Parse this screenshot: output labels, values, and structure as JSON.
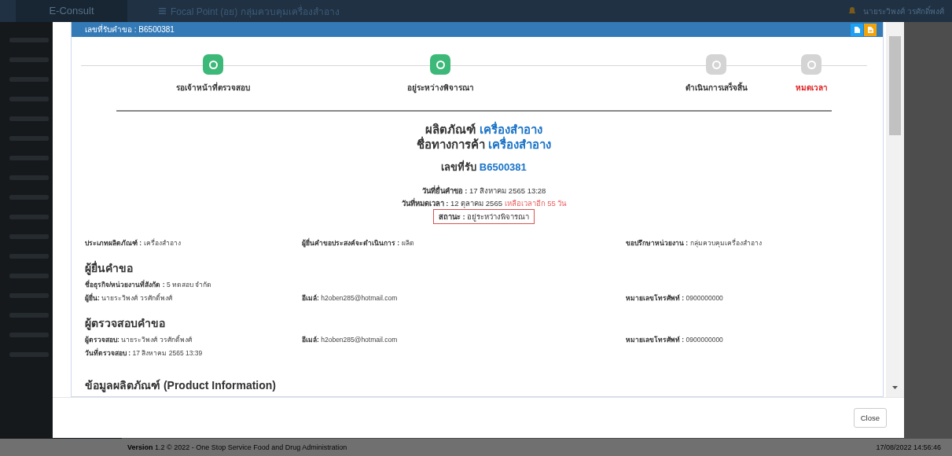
{
  "app": {
    "logo": "E-Consult",
    "header_title": "Focal Point (อย) กลุ่มควบคุมเครื่องสำอาง",
    "user_name": "นายระวิพงศ์ วรศักดิ์พงศ์",
    "footer": "**Version** 1.2 © 2022 - One Stop Service Food and Drug Administration",
    "timestamp": "17/08/2022 14:56:46"
  },
  "modal": {
    "title": "เลขที่รับคำขอ : B6500381",
    "steps": [
      {
        "label": "รอเจ้าหน้าที่ตรวจสอบ",
        "completed": true,
        "kind": "normal"
      },
      {
        "label": "อยู่ระหว่างพิจารณา",
        "completed": true,
        "kind": "normal"
      },
      {
        "label": "ดำเนินการเสร็จสิ้น",
        "completed": false,
        "kind": "normal"
      },
      {
        "label": "หมดเวลา",
        "completed": false,
        "kind": "expired"
      }
    ],
    "product": {
      "label": "ผลิตภัณฑ์",
      "value": "เครื่องสำอาง"
    },
    "trade_name": {
      "label": "ชื่อทางการค้า",
      "value": "เครื่องสำอาง"
    },
    "receipt": {
      "label": "เลขที่รับ",
      "value": "B6500381"
    },
    "submitted": {
      "label": "วันที่ยื่นคำขอ :",
      "value": "17 สิงหาคม 2565 13:28"
    },
    "expires": {
      "label": "วันที่หมดเวลา :",
      "value": "12 ตุลาคม 2565",
      "remaining": "เหลือเวลาอีก 55 วัน"
    },
    "status": {
      "label": "สถานะ :",
      "value": "อยู่ระหว่างพิจารณา"
    },
    "summary": [
      {
        "label": "ประเภทผลิตภัณฑ์ :",
        "value": "เครื่องสำอาง"
      },
      {
        "label": "ผู้ยื่นคำขอประสงค์จะดำเนินการ :",
        "value": "ผลิต"
      },
      {
        "label": "ขอปรึกษาหน่วยงาน :",
        "value": "กลุ่มควบคุมเครื่องสำอาง"
      }
    ],
    "sections": [
      {
        "heading": "ผู้ยื่นคำขอ",
        "rows": [
          [
            {
              "label": "ชื่อธุรกิจ/หน่วยงานที่สังกัด :",
              "value": "5 ทดสอบ จำกัด"
            }
          ],
          [
            {
              "label": "ผู้ยื่น:",
              "value": "นายระวิพงศ์ วรศักดิ์พงศ์"
            },
            {
              "label": "อีเมล์:",
              "value": "h2oben285@hotmail.com"
            },
            {
              "label": "หมายเลขโทรศัพท์ :",
              "value": "0900000000"
            }
          ]
        ]
      },
      {
        "heading": "ผู้ตรวจสอบคำขอ",
        "rows": [
          [
            {
              "label": "ผู้ตรวจสอบ:",
              "value": "นายระวิพงศ์ วรศักดิ์พงศ์"
            },
            {
              "label": "อีเมล์:",
              "value": "h2oben285@hotmail.com"
            },
            {
              "label": "หมายเลขโทรศัพท์ :",
              "value": "0900000000"
            }
          ],
          [
            {
              "label": "วันที่ตรวจสอบ :",
              "value": "17 สิงหาคม 2565 13:39"
            }
          ]
        ]
      }
    ],
    "next_heading": "ข้อมูลผลิตภัณฑ์ (Product Information)",
    "close_button": "Close"
  }
}
